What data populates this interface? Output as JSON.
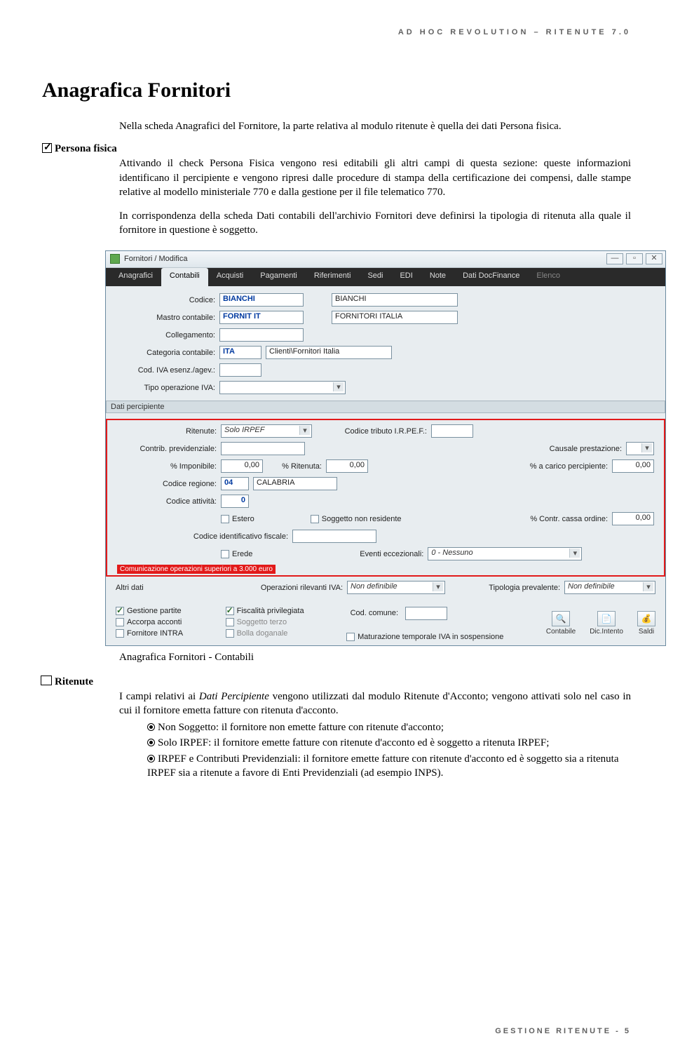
{
  "header": "AD HOC REVOLUTION – RITENUTE 7.0",
  "title": "Anagrafica Fornitori",
  "intro_para": "Nella scheda Anagrafici del Fornitore, la parte relativa al modulo ritenute è quella dei dati Persona fisica.",
  "section1": {
    "label": "Persona fisica",
    "text": "Attivando il check Persona Fisica vengono resi editabili gli altri campi di questa sezione: queste informazioni identificano il percipiente e vengono ripresi dalle procedure di stampa della certificazione dei compensi, dalle stampe relative al modello ministeriale 770 e dalla gestione per il file telematico 770."
  },
  "para2": "In corrispondenza della scheda Dati contabili dell'archivio Fornitori deve definirsi la tipologia di ritenuta alla quale il fornitore in questione è soggetto.",
  "window": {
    "title": "Fornitori / Modifica",
    "btns": {
      "min": "—",
      "max": "▫",
      "close": "✕"
    },
    "tabs": [
      "Anagrafici",
      "Contabili",
      "Acquisti",
      "Pagamenti",
      "Riferimenti",
      "Sedi",
      "EDI",
      "Note",
      "Dati DocFinance",
      "Elenco"
    ],
    "active_tab": 1,
    "form": {
      "codice_lbl": "Codice:",
      "codice_val": "BIANCHI",
      "codice_desc": "BIANCHI",
      "mastro_lbl": "Mastro contabile:",
      "mastro_val": "FORNIT IT",
      "mastro_desc": "FORNITORI ITALIA",
      "colleg_lbl": "Collegamento:",
      "catcont_lbl": "Categoria contabile:",
      "catcont_val": "ITA",
      "catcont_desc": "Clienti\\Fornitori Italia",
      "codiva_lbl": "Cod. IVA esenz./agev.:",
      "tipoop_lbl": "Tipo operazione IVA:"
    },
    "percipiente": {
      "bar": "Dati percipiente",
      "ritenute_lbl": "Ritenute:",
      "ritenute_val": "Solo IRPEF",
      "codtrib_lbl": "Codice tributo I.R.PE.F.:",
      "contrib_lbl": "Contrib. previdenziale:",
      "causprest_lbl": "Causale prestazione:",
      "pimp_lbl": "% Imponibile:",
      "pimp_val": "0,00",
      "prit_lbl": "% Ritenuta:",
      "prit_val": "0,00",
      "pcarico_lbl": "% a carico percipiente:",
      "pcarico_val": "0,00",
      "codreg_lbl": "Codice regione:",
      "codreg_val": "04",
      "codreg_desc": "CALABRIA",
      "codatt_lbl": "Codice attività:",
      "codatt_val": "0",
      "cb_estero": "Estero",
      "cb_soggnr": "Soggetto non residente",
      "pcassa_lbl": "% Contr. cassa ordine:",
      "pcassa_val": "0,00",
      "codfisc_lbl": "Codice identificativo fiscale:",
      "cb_erede": "Erede",
      "eventi_lbl": "Eventi eccezionali:",
      "eventi_val": "0 - Nessuno",
      "red_note": "Comunicazione operazioni superiori a 3.000 euro"
    },
    "altri": {
      "label": "Altri dati",
      "oprilev_lbl": "Operazioni rilevanti IVA:",
      "oprilev_val": "Non definibile",
      "tipprev_lbl": "Tipologia prevalente:",
      "tipprev_val": "Non definibile",
      "cb_gestpart": "Gestione partite",
      "cb_fiscpriv": "Fiscalità privilegiata",
      "codcom_lbl": "Cod. comune:",
      "cb_accorpa": "Accorpa acconti",
      "cb_soggterzo": "Soggetto terzo",
      "cb_fornintra": "Fornitore INTRA",
      "cb_bolla": "Bolla doganale",
      "cb_matur": "Maturazione temporale IVA in sospensione",
      "tools": {
        "contabile": "Contabile",
        "dicintento": "Dic.Intento",
        "saldi": "Saldi"
      }
    }
  },
  "caption": "Anagrafica Fornitori - Contabili",
  "ritenute": {
    "label": "Ritenute",
    "intro": "I campi relativi ai Dati Percipiente vengono utilizzati dal modulo Ritenute d'Acconto; vengono attivati solo nel caso in cui il fornitore emetta fatture con ritenuta d'acconto.",
    "b1": "Non Soggetto: il fornitore non emette fatture con ritenute d'acconto;",
    "b2": "Solo IRPEF: il fornitore emette fatture con ritenute d'acconto ed è soggetto a ritenuta IRPEF;",
    "b3": "IRPEF e Contributi Previdenziali: il fornitore emette fatture con ritenute d'acconto ed è soggetto sia a ritenuta IRPEF sia a ritenute a favore di Enti Previdenziali (ad esempio INPS)."
  },
  "footer": "GESTIONE RITENUTE - 5"
}
